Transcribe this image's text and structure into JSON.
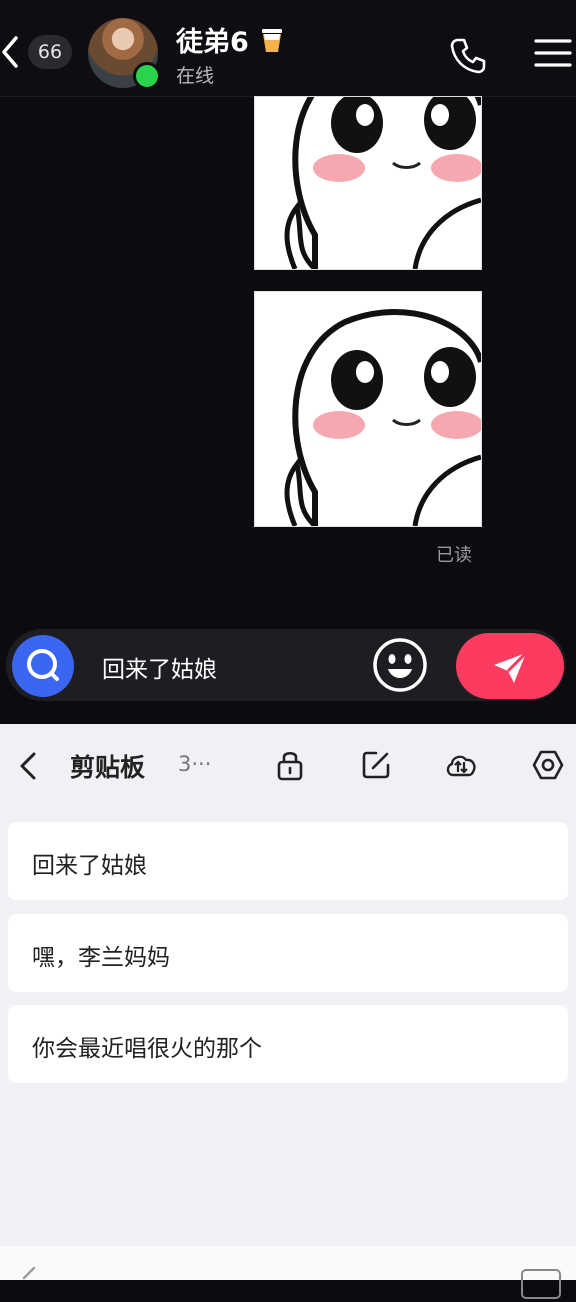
{
  "header": {
    "unread_count": "66",
    "contact_name": "徒弟6",
    "status": "在线",
    "name_badge_icon": "cup-icon"
  },
  "messages": [
    {
      "type": "sticker",
      "icon": "blush-ghost-sticker"
    },
    {
      "type": "sticker",
      "icon": "blush-ghost-sticker"
    }
  ],
  "read_receipt": "已读",
  "input": {
    "value": "回来了姑娘"
  },
  "clipboard": {
    "title": "剪贴板",
    "count": "3···",
    "items": [
      {
        "text": "回来了姑娘"
      },
      {
        "text": "嘿，李兰妈妈"
      },
      {
        "text": "你会最近唱很火的那个"
      }
    ]
  },
  "colors": {
    "accent_blue": "#3a66f2",
    "send_red": "#fb3b60",
    "online_green": "#2bd24c"
  }
}
